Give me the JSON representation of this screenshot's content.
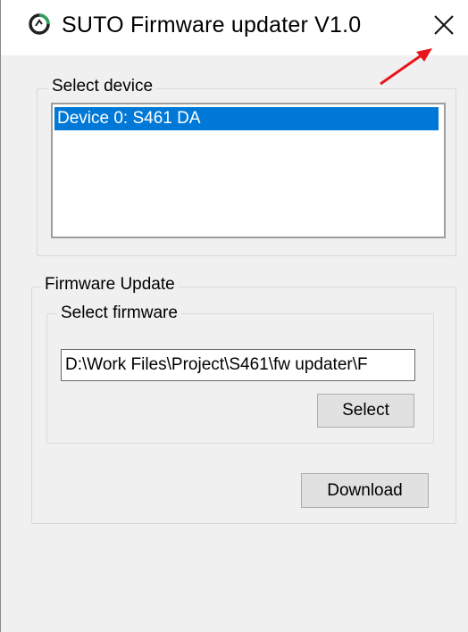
{
  "window": {
    "title": "SUTO Firmware updater V1.0",
    "close_glyph": "×"
  },
  "device_group": {
    "legend": "Select device",
    "devices": [
      "Device 0: S461 DA"
    ],
    "selected_index": 0
  },
  "firmware_group": {
    "legend": "Firmware Update",
    "select_firmware": {
      "legend": "Select firmware",
      "path_value": "D:\\Work Files\\Project\\S461\\fw updater\\F",
      "select_button": "Select"
    },
    "download_button": "Download"
  },
  "colors": {
    "selection": "#0078d7",
    "arrow": "#e8161b",
    "icon": "#3a9b5a"
  },
  "icons": {
    "app": "app-logo-icon",
    "close": "close-icon",
    "annotation": "red-arrow-icon"
  }
}
